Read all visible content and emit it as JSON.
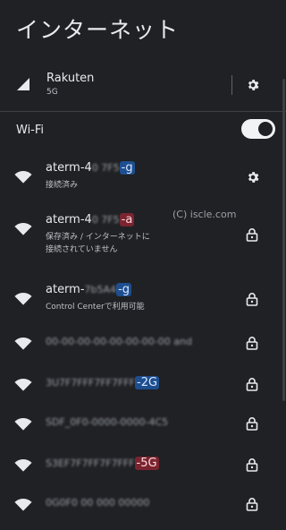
{
  "header": {
    "title": "インターネット"
  },
  "mobile": {
    "carrier": "Rakuten",
    "network_type": "5G"
  },
  "wifi": {
    "label": "Wi-Fi",
    "enabled": true
  },
  "watermark": "(C) iscle.com",
  "networks": [
    {
      "prefix": "aterm-4",
      "masked": "0 7F5",
      "suffix": "-g",
      "suffix_style": "blue",
      "status": "接続済み",
      "status2": ""
    },
    {
      "prefix": "aterm-4",
      "masked": "0 7F5",
      "suffix": "-a",
      "suffix_style": "red",
      "status": "保存済み / インターネットに",
      "status2": "接続されていません"
    },
    {
      "prefix": "aterm-",
      "masked": "7b5A4",
      "suffix": "-g",
      "suffix_style": "blue",
      "status": "Control Centerで利用可能",
      "status2": ""
    },
    {
      "prefix": "",
      "masked": "00-00-00-00-00-00-00-00 and",
      "suffix": "",
      "suffix_style": "",
      "status": "",
      "status2": ""
    },
    {
      "prefix": "",
      "masked": "3U7F7FFF7FF7FFF",
      "suffix": "-2G",
      "suffix_style": "blue",
      "status": "",
      "status2": ""
    },
    {
      "prefix": "",
      "masked": "SDF_0F0-0000-0000-4C5",
      "suffix": "",
      "suffix_style": "",
      "status": "",
      "status2": ""
    },
    {
      "prefix": "",
      "masked": "S3EF7F7FF7F7FFF",
      "suffix": "-5G",
      "suffix_style": "red",
      "status": "",
      "status2": ""
    },
    {
      "prefix": "",
      "masked": "0G0F0 00 000 00000",
      "suffix": "",
      "suffix_style": "",
      "status": "",
      "status2": ""
    }
  ]
}
